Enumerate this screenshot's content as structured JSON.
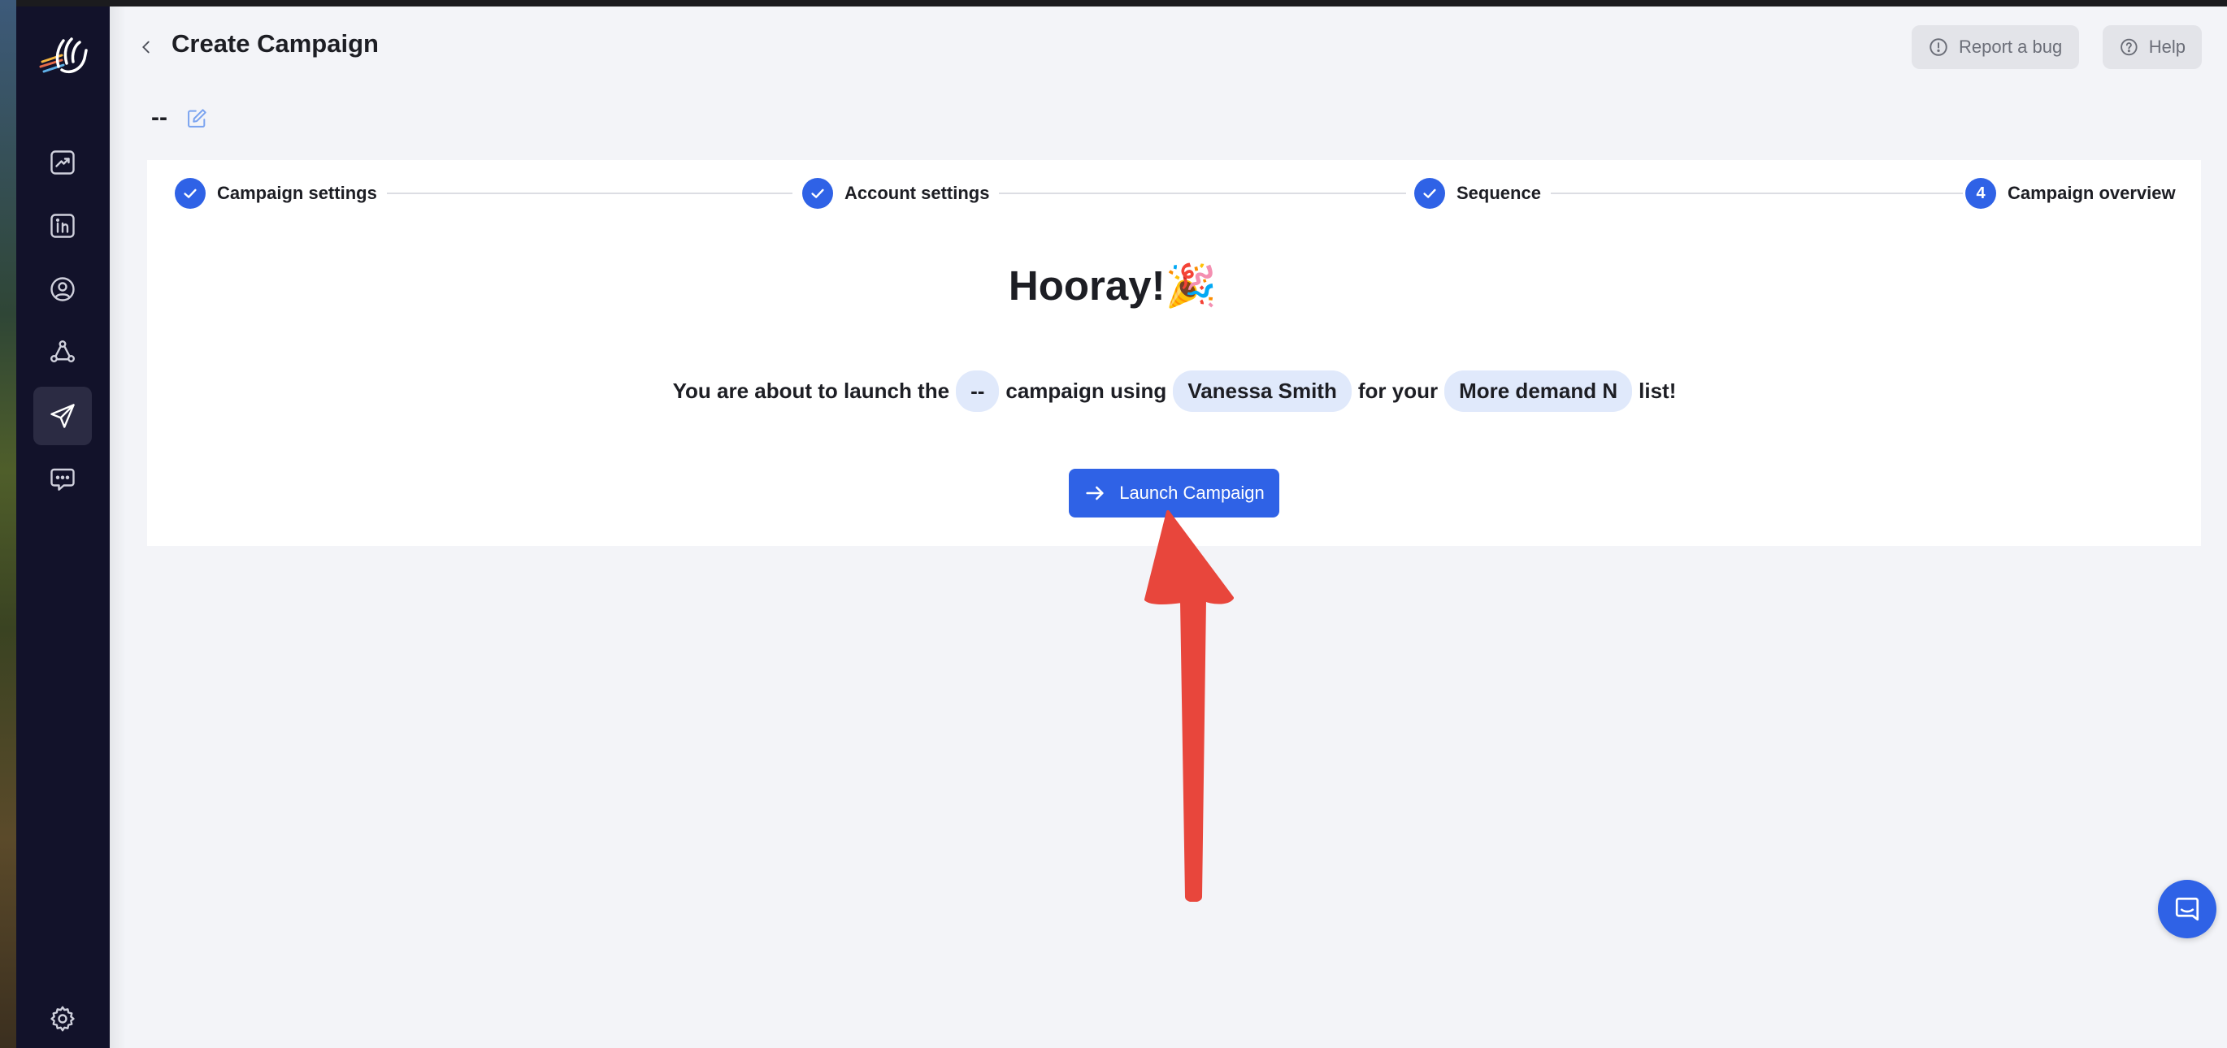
{
  "header": {
    "title": "Create Campaign",
    "report_bug_label": "Report a bug",
    "help_label": "Help"
  },
  "campaign": {
    "name": "--"
  },
  "stepper": {
    "steps": [
      {
        "label": "Campaign settings",
        "state": "done"
      },
      {
        "label": "Account settings",
        "state": "done"
      },
      {
        "label": "Sequence",
        "state": "done"
      },
      {
        "label": "Campaign overview",
        "state": "current",
        "number": "4"
      }
    ]
  },
  "overview": {
    "heading": "Hooray!",
    "heading_emoji": "🎉",
    "text_1": "You are about to launch the",
    "campaign_pill": "--",
    "text_2": "campaign using",
    "account_pill": "Vanessa Smith",
    "text_3": "for your",
    "list_pill": "More demand N",
    "text_4": "list!",
    "launch_label": "Launch Campaign"
  },
  "sidebar": {
    "items": [
      {
        "icon": "analytics-icon",
        "active": false
      },
      {
        "icon": "linkedin-icon",
        "active": false
      },
      {
        "icon": "user-icon",
        "active": false
      },
      {
        "icon": "network-icon",
        "active": false
      },
      {
        "icon": "send-icon",
        "active": true
      },
      {
        "icon": "chat-icon",
        "active": false
      }
    ],
    "bottom": {
      "icon": "gear-icon"
    }
  },
  "colors": {
    "sidebar_bg": "#12122a",
    "accent": "#2f62e6",
    "annotation_arrow": "#e8463c"
  }
}
